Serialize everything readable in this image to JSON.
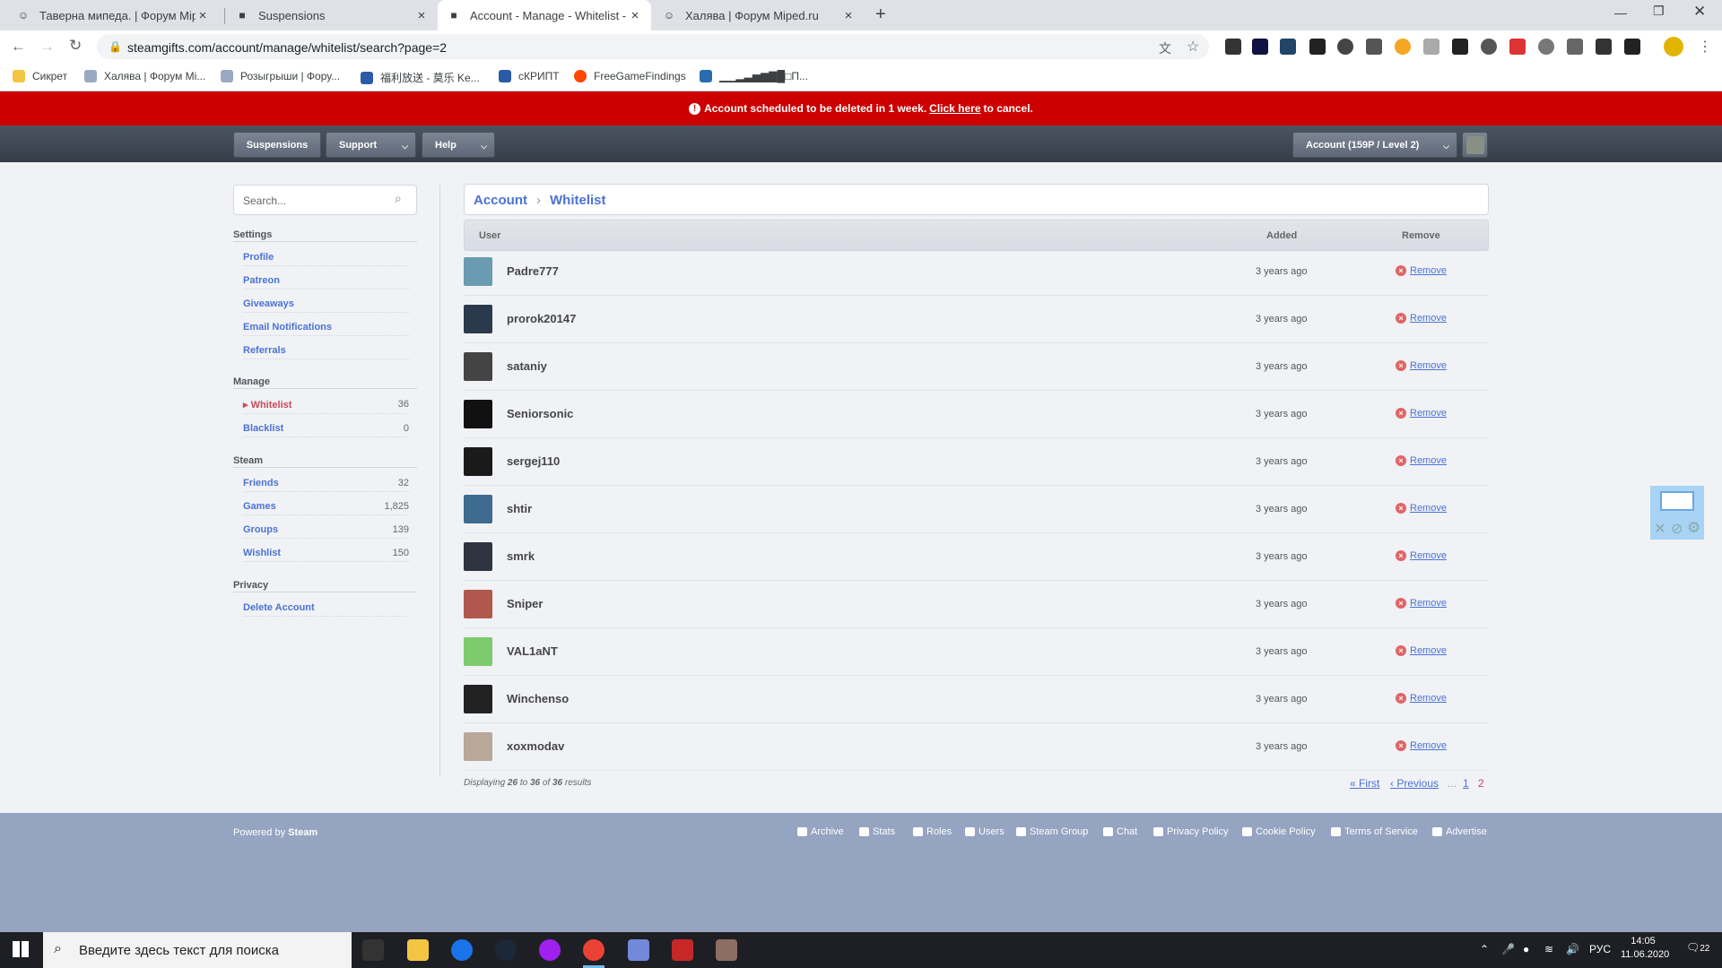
{
  "browser": {
    "tabs": [
      {
        "title": "Таверна мипеда. | Форум Miped.ru",
        "active": false
      },
      {
        "title": "Suspensions",
        "active": false
      },
      {
        "title": "Account - Manage - Whitelist - P",
        "active": true
      },
      {
        "title": "Халява | Форум Miped.ru",
        "active": false
      }
    ],
    "url": "steamgifts.com/account/manage/whitelist/search?page=2",
    "bookmarks": [
      "Сикрет",
      "Халява | Форум Mi...",
      "Розыгрыши | Фору...",
      "福利放送 - 莫乐 Ke...",
      "сКРИПТ",
      "FreeGameFindings",
      "▁▁▂▃▅▆▇█□П..."
    ]
  },
  "banner": {
    "text_before": "Account scheduled to be deleted in 1 week.",
    "link": "Click here",
    "text_after": "to cancel."
  },
  "nav": {
    "suspensions": "Suspensions",
    "support": "Support",
    "help": "Help",
    "account": "Account (159P / Level 2)"
  },
  "sidebar": {
    "search_placeholder": "Search...",
    "settings_heading": "Settings",
    "settings": [
      "Profile",
      "Patreon",
      "Giveaways",
      "Email Notifications",
      "Referrals"
    ],
    "manage_heading": "Manage",
    "manage": [
      {
        "label": "Whitelist",
        "count": "36"
      },
      {
        "label": "Blacklist",
        "count": "0"
      }
    ],
    "steam_heading": "Steam",
    "steam": [
      {
        "label": "Friends",
        "count": "32"
      },
      {
        "label": "Games",
        "count": "1,825"
      },
      {
        "label": "Groups",
        "count": "139"
      },
      {
        "label": "Wishlist",
        "count": "150"
      }
    ],
    "privacy_heading": "Privacy",
    "privacy": [
      "Delete Account"
    ]
  },
  "breadcrumb": {
    "first": "Account",
    "second": "Whitelist"
  },
  "table": {
    "headers": {
      "user": "User",
      "added": "Added",
      "remove": "Remove"
    },
    "rows": [
      {
        "user": "Padre777",
        "added": "3 years ago",
        "remove": "Remove",
        "avatar_color": "#6a9bb0"
      },
      {
        "user": "prorok20147",
        "added": "3 years ago",
        "remove": "Remove",
        "avatar_color": "#2a3a4c"
      },
      {
        "user": "sataniy",
        "added": "3 years ago",
        "remove": "Remove",
        "avatar_color": "#444"
      },
      {
        "user": "Seniorsonic",
        "added": "3 years ago",
        "remove": "Remove",
        "avatar_color": "#111"
      },
      {
        "user": "sergej110",
        "added": "3 years ago",
        "remove": "Remove",
        "avatar_color": "#1a1a1a"
      },
      {
        "user": "shtir",
        "added": "3 years ago",
        "remove": "Remove",
        "avatar_color": "#3e6b8f"
      },
      {
        "user": "smrk",
        "added": "3 years ago",
        "remove": "Remove",
        "avatar_color": "#2e3440"
      },
      {
        "user": "Sniper",
        "added": "3 years ago",
        "remove": "Remove",
        "avatar_color": "#b0584e"
      },
      {
        "user": "VAL1aNT",
        "added": "3 years ago",
        "remove": "Remove",
        "avatar_color": "#7ecb6e"
      },
      {
        "user": "Winchenso",
        "added": "3 years ago",
        "remove": "Remove",
        "avatar_color": "#222"
      },
      {
        "user": "xoxmodav",
        "added": "3 years ago",
        "remove": "Remove",
        "avatar_color": "#b7a89a"
      }
    ]
  },
  "pagination": {
    "prefix": "Displaying",
    "from": "26",
    "to_word": "to",
    "to": "36",
    "of_word": "of",
    "total": "36",
    "suffix": "results",
    "first": "« First",
    "previous": "‹ Previous",
    "ellipsis": "...",
    "page1": "1",
    "page2": "2"
  },
  "footer": {
    "powered_prefix": "Powered by",
    "powered_link": "Steam",
    "links": [
      "Archive",
      "Stats",
      "Roles",
      "Users",
      "Steam Group",
      "Chat",
      "Privacy Policy",
      "Cookie Policy",
      "Terms of Service",
      "Advertise"
    ]
  },
  "taskbar": {
    "search_placeholder": "Введите здесь текст для поиска",
    "lang": "РУС",
    "time": "14:05",
    "date": "11.06.2020",
    "notifications": "22"
  },
  "colors": {
    "banner": "#cc0000",
    "link": "#4b72d4",
    "selected": "#c94a5b",
    "footer": "#95a4c0"
  }
}
